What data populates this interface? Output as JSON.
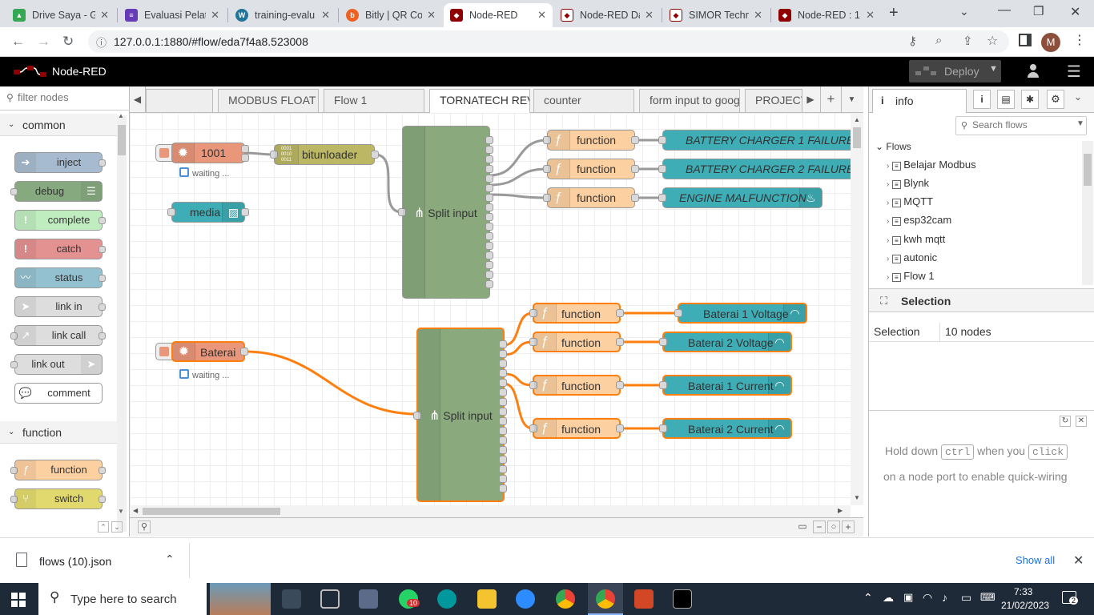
{
  "browser": {
    "tabs": [
      {
        "label": "Drive Saya - G",
        "color": "#34a853"
      },
      {
        "label": "Evaluasi Pelat",
        "color": "#673ab7"
      },
      {
        "label": "training-evalu",
        "color": "#21759b"
      },
      {
        "label": "Bitly | QR Coo",
        "color": "#ee6123"
      },
      {
        "label": "Node-RED",
        "color": "#8f0000"
      },
      {
        "label": "Node-RED Da",
        "color": "#8f0000"
      },
      {
        "label": "SIMOR Techn",
        "color": "#8f0000"
      },
      {
        "label": "Node-RED : 1",
        "color": "#8f0000"
      }
    ],
    "url": "127.0.0.1:1880/#flow/eda7f4a8.523008",
    "profile_initial": "M"
  },
  "header": {
    "title": "Node-RED",
    "deploy_label": "Deploy"
  },
  "palette": {
    "filter_placeholder": "filter nodes",
    "categories": [
      {
        "name": "common",
        "nodes": [
          "inject",
          "debug",
          "complete",
          "catch",
          "status",
          "link in",
          "link call",
          "link out",
          "comment"
        ]
      },
      {
        "name": "function",
        "nodes": [
          "function",
          "switch"
        ]
      }
    ]
  },
  "workspace": {
    "tabs": [
      "MODBUS FLOAT",
      "Flow 1",
      "TORNATECH REV",
      "counter",
      "form input to google",
      "PROJECT"
    ],
    "active_tab": "TORNATECH REV"
  },
  "flow": {
    "inject1": {
      "label": "1001",
      "status": "waiting ..."
    },
    "bitunloader": {
      "label": "bitunloader"
    },
    "media": {
      "label": "media"
    },
    "split1": {
      "label": "Split input"
    },
    "functions_top": [
      "function",
      "function",
      "function"
    ],
    "outputs_top": [
      "BATTERY CHARGER 1 FAILURE",
      "BATTERY CHARGER 2 FAILURE",
      "ENGINE MALFUNCTION"
    ],
    "inject2": {
      "label": "Baterai",
      "status": "waiting ..."
    },
    "split2": {
      "label": "Split input"
    },
    "functions_bottom": [
      "function",
      "function",
      "function",
      "function"
    ],
    "outputs_bottom": [
      "Baterai 1 Voltage",
      "Baterai 2 Voltage",
      "Baterai 1 Current",
      "Baterai 2 Current"
    ]
  },
  "sidebar": {
    "tab_label": "info",
    "search_placeholder": "Search flows",
    "flows_heading": "Flows",
    "flows": [
      "Belajar Modbus",
      "Blynk",
      "MQTT",
      "esp32cam",
      "kwh mqtt",
      "autonic",
      "Flow 1"
    ],
    "selection_heading": "Selection",
    "selection_key": "Selection",
    "selection_value": "10 nodes",
    "tip_1": "Hold down",
    "tip_key_1": "ctrl",
    "tip_2": "when you",
    "tip_key_2": "click",
    "tip_3": "on a node port to enable quick-wiring"
  },
  "downloads": {
    "file": "flows (10).json",
    "show_all": "Show all"
  },
  "taskbar": {
    "search_placeholder": "Type here to search",
    "time": "7:33",
    "date": "21/02/2023",
    "whatsapp_badge": "10",
    "notif_badge": "2"
  }
}
